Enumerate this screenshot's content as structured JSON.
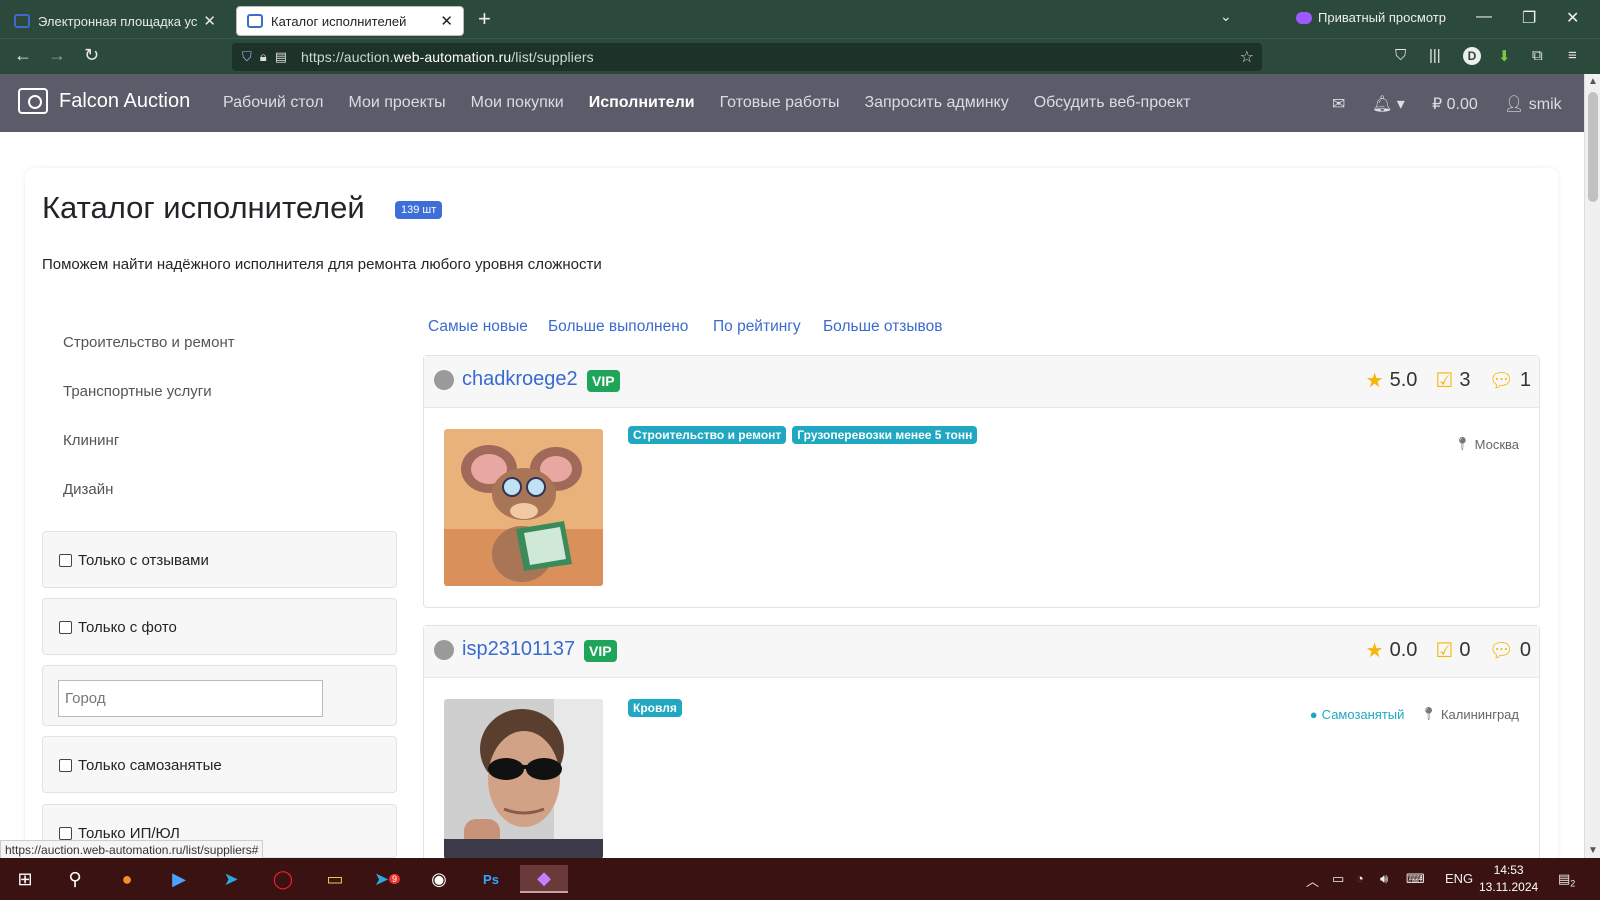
{
  "browser": {
    "tabs": [
      {
        "title": "Электронная площадка услуг",
        "active": false
      },
      {
        "title": "Каталог исполнителей",
        "active": true
      }
    ],
    "private_label": "Приватный просмотр",
    "url_prefix": "https://auction.",
    "url_host": "web-automation.ru",
    "url_path": "/list/suppliers",
    "status_url": "https://auction.web-automation.ru/list/suppliers#"
  },
  "site": {
    "brand": "Falcon Auction",
    "nav": [
      "Рабочий стол",
      "Мои проекты",
      "Мои покупки",
      "Исполнители",
      "Готовые работы",
      "Запросить админку",
      "Обсудить веб-проект"
    ],
    "active_nav": "Исполнители",
    "balance": "0.00",
    "user": "smik"
  },
  "page": {
    "title": "Каталог исполнителей",
    "count": "139 шт",
    "subtitle": "Поможем найти надёжного исполнителя для ремонта любого уровня сложности"
  },
  "categories": [
    "Строительство и ремонт",
    "Транспортные услуги",
    "Клининг",
    "Дизайн"
  ],
  "filters": {
    "reviews_only": "Только с отзывами",
    "photo_only": "Только с фото",
    "city_placeholder": "Город",
    "selfemployed_only": "Только самозанятые",
    "ip_only": "Только ИП/ЮЛ"
  },
  "sort": [
    "Самые новые",
    "Больше выполнено",
    "По рейтингу",
    "Больше отзывов"
  ],
  "suppliers": [
    {
      "name": "chadkroege2",
      "vip": "VIP",
      "rating": "5.0",
      "completed": "3",
      "reviews": "1",
      "tags": [
        "Строительство и ремонт",
        "Грузоперевозки менее 5 тонн"
      ],
      "self_employed": "",
      "city": "Москва"
    },
    {
      "name": "isp23101137",
      "vip": "VIP",
      "rating": "0.0",
      "completed": "0",
      "reviews": "0",
      "tags": [
        "Кровля"
      ],
      "self_employed": "Самозанятый",
      "city": "Калининград"
    }
  ],
  "taskbar": {
    "lang": "ENG",
    "time": "14:53",
    "date": "13.11.2024",
    "notifications": "2",
    "telegram_badge": "9"
  },
  "colors": {
    "link": "#3a6ad0",
    "vip": "#1fa55a",
    "tag": "#20a7c2",
    "nav_bg": "#5b5b6a",
    "browser_bg": "#2b4a3c",
    "taskbar_bg": "#3b1212"
  }
}
